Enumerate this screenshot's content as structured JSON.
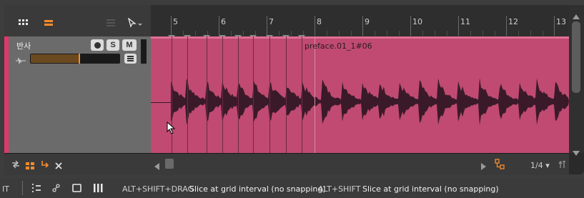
{
  "ruler": {
    "bars": [
      "5",
      "6",
      "7",
      "8",
      "9",
      "10",
      "11",
      "12",
      "13"
    ]
  },
  "track": {
    "name": "반사",
    "record_label": "●",
    "solo_label": "S",
    "mute_label": "M",
    "volume_fraction": 0.54,
    "color": "#e0386b"
  },
  "clip": {
    "name": "preface.01_1#06",
    "color": "#c04a72"
  },
  "bottom_bar": {
    "grid_label": "1/4 ▾"
  },
  "status_bar": {
    "mode_label": "IT",
    "hint1_key": "ALT+SHIFT+DRAG",
    "hint1_text": "Slice at grid interval (no snapping)",
    "hint2_key": "ALT+SHIFT",
    "hint2_text": "Slice at grid interval (no snapping)"
  },
  "colors": {
    "accent": "#ff8c2a",
    "clip_waveform": "#3a1a28"
  }
}
